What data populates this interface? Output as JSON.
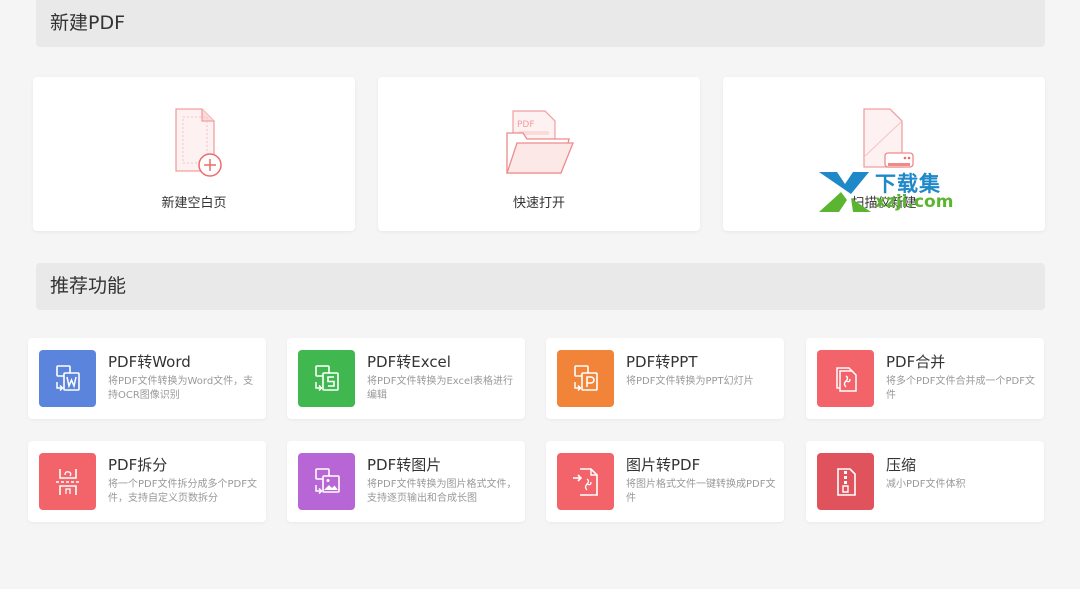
{
  "sections": {
    "new_pdf": "新建PDF",
    "recommended": "推荐功能"
  },
  "new_cards": [
    {
      "label": "新建空白页",
      "icon": "blank-page-icon"
    },
    {
      "label": "快速打开",
      "icon": "open-folder-icon"
    },
    {
      "label": "扫描仪新建",
      "icon": "scanner-icon"
    }
  ],
  "features": [
    {
      "title": "PDF转Word",
      "desc": "将PDF文件转换为Word文件，支持OCR图像识别",
      "color": "#5b85dc",
      "icon": "pdf-to-word-icon"
    },
    {
      "title": "PDF转Excel",
      "desc": "将PDF文件转换为Excel表格进行编辑",
      "color": "#41b84f",
      "icon": "pdf-to-excel-icon"
    },
    {
      "title": "PDF转PPT",
      "desc": "将PDF文件转换为PPT幻灯片",
      "color": "#f2843a",
      "icon": "pdf-to-ppt-icon"
    },
    {
      "title": "PDF合并",
      "desc": "将多个PDF文件合并成一个PDF文件",
      "color": "#f2636a",
      "icon": "pdf-merge-icon"
    },
    {
      "title": "PDF拆分",
      "desc": "将一个PDF文件拆分成多个PDF文件，支持自定义页数拆分",
      "color": "#f2636a",
      "icon": "pdf-split-icon"
    },
    {
      "title": "PDF转图片",
      "desc": "将PDF文件转换为图片格式文件，支持逐页输出和合成长图",
      "color": "#b866d6",
      "icon": "pdf-to-image-icon"
    },
    {
      "title": "图片转PDF",
      "desc": "将图片格式文件一键转换成PDF文件",
      "color": "#f2636a",
      "icon": "image-to-pdf-icon"
    },
    {
      "title": "压缩",
      "desc": "减小PDF文件体积",
      "color": "#e0535c",
      "icon": "compress-icon"
    }
  ],
  "watermark": {
    "top": "下载集",
    "bottom": "xzji.com"
  }
}
